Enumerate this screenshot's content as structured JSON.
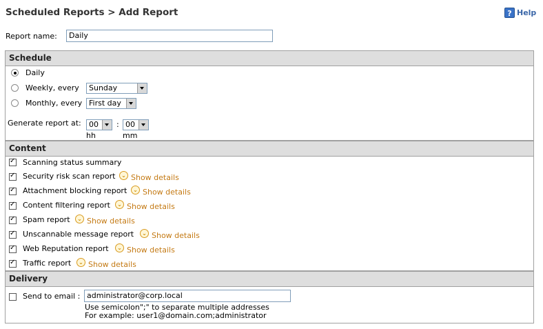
{
  "header": {
    "title": "Scheduled Reports > Add Report",
    "help_label": "Help"
  },
  "report_name": {
    "label": "Report name:",
    "value": "Daily"
  },
  "schedule": {
    "heading": "Schedule",
    "daily_label": "Daily",
    "weekly_label": "Weekly, every",
    "weekly_value": "Sunday",
    "monthly_label": "Monthly, every",
    "monthly_value": "First day",
    "generate_label": "Generate report at:",
    "hour_value": "00",
    "minute_value": "00",
    "separator": ":",
    "hh_label": "hh",
    "mm_label": "mm",
    "selected": "Daily"
  },
  "content": {
    "heading": "Content",
    "show_details_label": "Show details",
    "items": [
      {
        "label": "Scanning status summary",
        "checked": true,
        "details": false
      },
      {
        "label": "Security risk scan report",
        "checked": true,
        "details": true
      },
      {
        "label": "Attachment blocking report",
        "checked": true,
        "details": true
      },
      {
        "label": "Content filtering report",
        "checked": true,
        "details": true
      },
      {
        "label": "Spam report",
        "checked": true,
        "details": true
      },
      {
        "label": "Unscannable message report",
        "checked": true,
        "details": true
      },
      {
        "label": "Web Reputation report",
        "checked": true,
        "details": true
      },
      {
        "label": "Traffic report",
        "checked": true,
        "details": true
      }
    ]
  },
  "delivery": {
    "heading": "Delivery",
    "send_label": "Send to email :",
    "send_checked": false,
    "email_value": "administrator@corp.local",
    "hint1": "Use semicolon\";\" to separate multiple addresses",
    "hint2": "For example: user1@domain.com;administrator"
  },
  "colors": {
    "section_header_bg": "#dedede",
    "link": "#c47a14",
    "help_icon": "#3a73c8"
  }
}
